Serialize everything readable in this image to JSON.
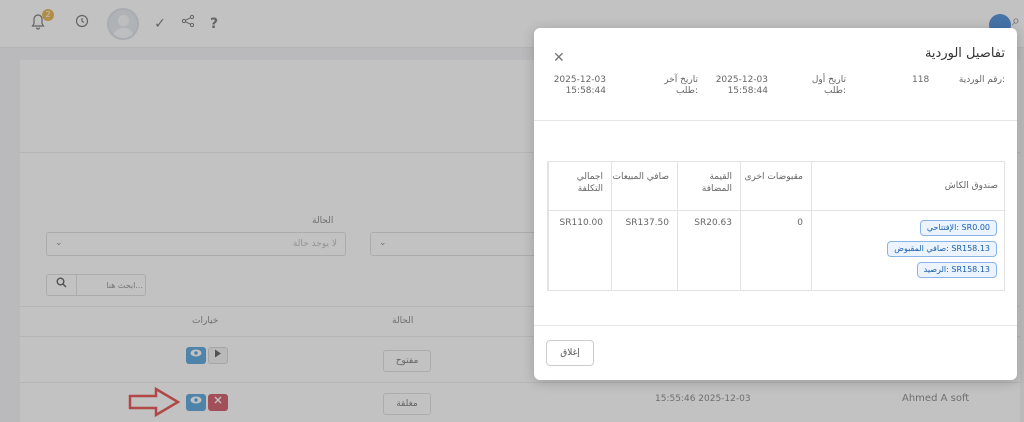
{
  "topbar": {
    "notification_count": "2",
    "icons": [
      "bell-icon",
      "clock-icon",
      "avatar",
      "check-icon",
      "share-icon",
      "help-icon",
      "user-icon",
      "search-icon"
    ],
    "check_glyph": "✓",
    "help_glyph": "?"
  },
  "filters": {
    "state_label": "الحالة",
    "state_placeholder": "لا يوجد حالة",
    "search_placeholder": "ابحث هنا..."
  },
  "table": {
    "headers": {
      "options": "خيارات",
      "state": "الحالة"
    },
    "rows": [
      {
        "state": "مفتوح",
        "time": "",
        "user": ""
      },
      {
        "state": "مغلقة",
        "time": "15:55:46 2025-12-03",
        "user": "Ahmed A soft"
      }
    ]
  },
  "modal": {
    "title": "تفاصيل الوردية",
    "shift_number_label": "رقم الوردية:",
    "shift_number": "118",
    "first_order_label": "تاريخ أول طلب:",
    "first_order_date": "2025-12-03",
    "first_order_time": "15:58:44",
    "last_order_label": "تاريخ آخر طلب:",
    "last_order_date": "2025-12-03",
    "last_order_time": "15:58:44",
    "columns": {
      "cash_box": "صندوق الكاش",
      "other_receipts": "مقبوضات اخرى",
      "vat": "القيمة المضافة",
      "net_sales": "صافي المبيعات",
      "total_cost": "اجمالي التكلفة"
    },
    "cash_box_pills": [
      "الإفتتاحي: SR0.00",
      "صافي المقبوض: SR158.13",
      "الرصيد: SR158.13"
    ],
    "values": {
      "other_receipts": "0",
      "vat": "SR20.63",
      "net_sales": "SR137.50",
      "total_cost": "SR110.00"
    },
    "close_button": "إغلاق"
  },
  "colors": {
    "primary": "#2f8fd4",
    "danger": "#c43140",
    "play": "#eeeeee",
    "arrow": "#e02020",
    "pill_bg": "#eaf3fe",
    "pill_border": "#8ab4e8"
  }
}
